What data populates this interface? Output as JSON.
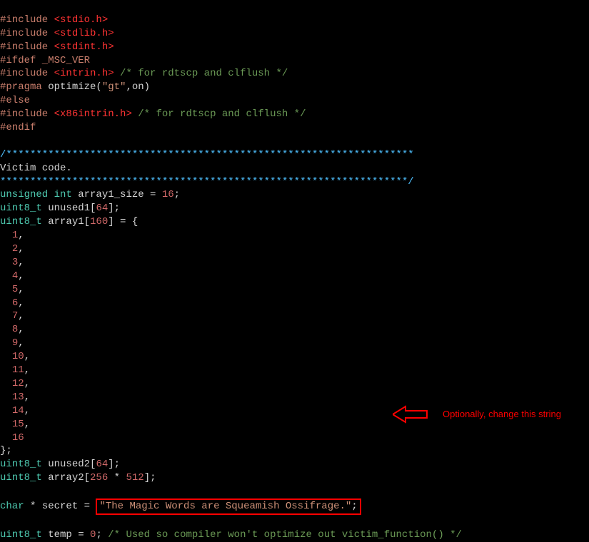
{
  "code": {
    "include1_label": "#include",
    "include1_header": "<stdio.h>",
    "include2_label": "#include",
    "include2_header": "<stdlib.h>",
    "include3_label": "#include",
    "include3_header": "<stdint.h>",
    "ifdef_line": "#ifdef _MSC_VER",
    "include4_label": "#include",
    "include4_header": "<intrin.h>",
    "include4_comment": "/* for rdtscp and clflush */",
    "pragma_pre": "#pragma",
    "pragma_kw": " optimize(",
    "pragma_str": "\"gt\"",
    "pragma_rest": ",on)",
    "else_line": "#else",
    "include5_label": "#include",
    "include5_header": "<x86intrin.h>",
    "include5_comment": "/* for rdtscp and clflush */",
    "endif_line": "#endif",
    "blockcomment_stars_open": "/********************************************************************",
    "blockcomment_title": "Victim code.",
    "blockcomment_stars_close": "********************************************************************/",
    "decl1_type": "unsigned int",
    "decl1_name": " array1_size = ",
    "decl1_val": "16",
    "decl1_end": ";",
    "decl2_type": "uint8_t",
    "decl2_name": " unused1[",
    "decl2_val": "64",
    "decl2_end": "];",
    "decl3_type": "uint8_t",
    "decl3_name": " array1[",
    "decl3_val": "160",
    "decl3_end": "] = {",
    "arr_vals": [
      "1",
      "2",
      "3",
      "4",
      "5",
      "6",
      "7",
      "8",
      "9",
      "10",
      "11",
      "12",
      "13",
      "14",
      "15",
      "16"
    ],
    "arr_close": "};",
    "decl4_type": "uint8_t",
    "decl4_name": " unused2[",
    "decl4_val": "64",
    "decl4_end": "];",
    "decl5_type": "uint8_t",
    "decl5_name": " array2[",
    "decl5_val1": "256",
    "decl5_op": " * ",
    "decl5_val2": "512",
    "decl5_end": "];",
    "secret_type": "char",
    "secret_mid": " * secret = ",
    "secret_string": "\"The Magic Words are Squeamish Ossifrage.\"",
    "secret_end": ";",
    "temp_type": "uint8_t",
    "temp_name": " temp = ",
    "temp_val": "0",
    "temp_end": "; ",
    "temp_comment": "/* Used so compiler won't optimize out victim_function() */"
  },
  "annotation": {
    "text": "Optionally, change this string"
  }
}
